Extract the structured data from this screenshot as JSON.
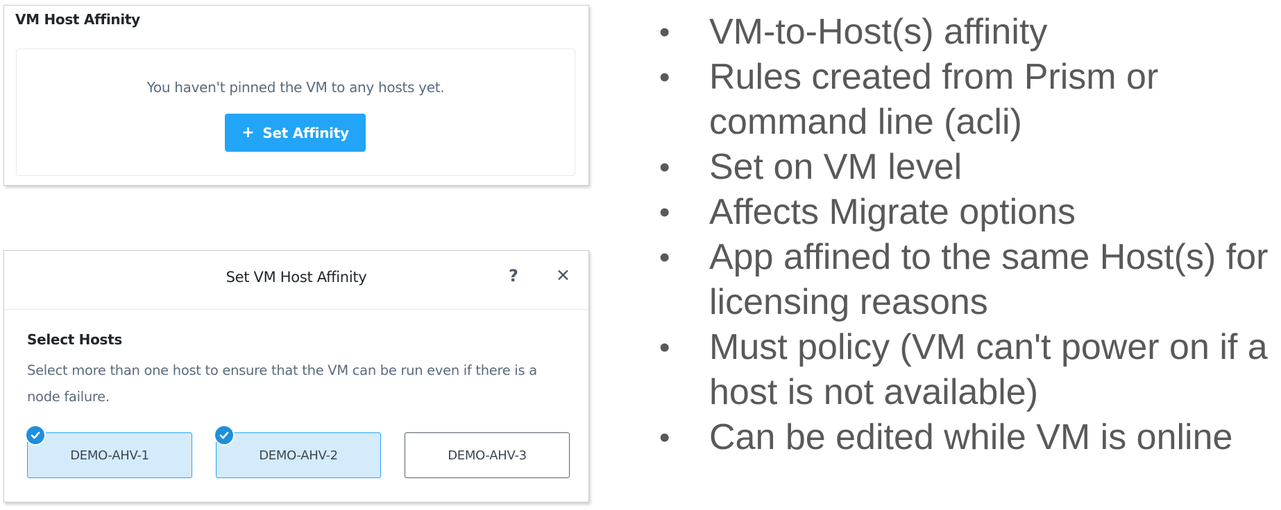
{
  "affinity_panel": {
    "title": "VM Host Affinity",
    "empty_message": "You haven't pinned the VM to any hosts yet.",
    "button_icon": "+",
    "button_label": "Set Affinity"
  },
  "dialog": {
    "title": "Set VM Host Affinity",
    "help_icon": "?",
    "close_icon": "✕",
    "section_label": "Select Hosts",
    "help_text": "Select more than one host to ensure that the VM can be run even if there is a node failure.",
    "hosts": [
      {
        "name": "DEMO-AHV-1",
        "selected": true
      },
      {
        "name": "DEMO-AHV-2",
        "selected": true
      },
      {
        "name": "DEMO-AHV-3",
        "selected": false
      }
    ]
  },
  "bullets": [
    "VM-to-Host(s) affinity",
    "Rules created from Prism or command line (acli)",
    "Set on VM level",
    "Affects Migrate options",
    "App affined to the same Host(s) for licensing reasons",
    "Must policy (VM can't power on if a host is not available)",
    "Can be edited while VM is online"
  ],
  "bullet_symbol": "•",
  "colors": {
    "accent": "#22a5f7",
    "selected_bg": "#d4ebfb",
    "bullet_text": "#595959"
  }
}
